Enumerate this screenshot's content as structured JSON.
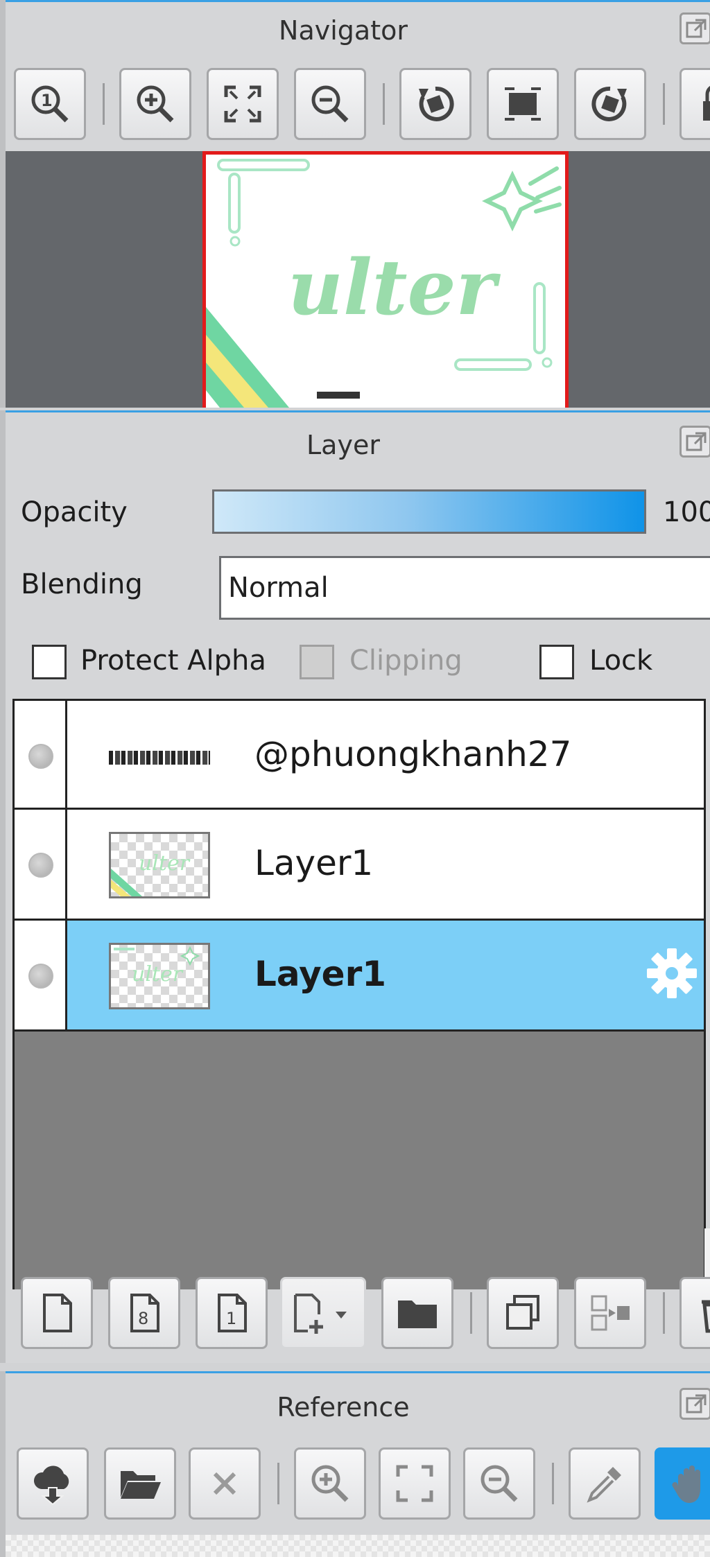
{
  "navigator": {
    "title": "Navigator",
    "toolbar": [
      "zoom-actual-size-icon",
      "zoom-in-icon",
      "fit-to-window-icon",
      "zoom-out-icon",
      "rotate-left-icon",
      "flip-horizontal-icon",
      "rotate-right-icon",
      "lock-icon"
    ],
    "preview_text": "ulter"
  },
  "layer_panel": {
    "title": "Layer",
    "opacity_label": "Opacity",
    "opacity_value": "100",
    "opacity_percent": 100,
    "blending_label": "Blending",
    "blending_value": "Normal",
    "protect_alpha_label": "Protect Alpha",
    "protect_alpha_checked": false,
    "clipping_label": "Clipping",
    "clipping_enabled": false,
    "lock_label": "Lock",
    "lock_checked": false,
    "layers": [
      {
        "name": "@phuongkhanh27",
        "selected": false
      },
      {
        "name": "Layer1",
        "selected": false
      },
      {
        "name": "Layer1",
        "selected": true
      }
    ],
    "bottom_toolbar": [
      "new-layer-icon",
      "new-8bit-layer-icon",
      "new-1bit-layer-icon",
      "add-layer-menu-icon",
      "new-folder-icon",
      "duplicate-layer-icon",
      "merge-down-icon",
      "delete-layer-icon"
    ]
  },
  "reference": {
    "title": "Reference",
    "toolbar": [
      "download-icon",
      "open-folder-icon",
      "close-icon",
      "zoom-in-icon",
      "fit-to-window-icon",
      "zoom-out-icon",
      "eyedropper-icon",
      "hand-icon"
    ]
  },
  "colors": {
    "selected_row": "#7ccff7",
    "accent": "#1e9ae8",
    "canvas_border": "#e21b1b",
    "preview_green": "#8fdcaa"
  }
}
